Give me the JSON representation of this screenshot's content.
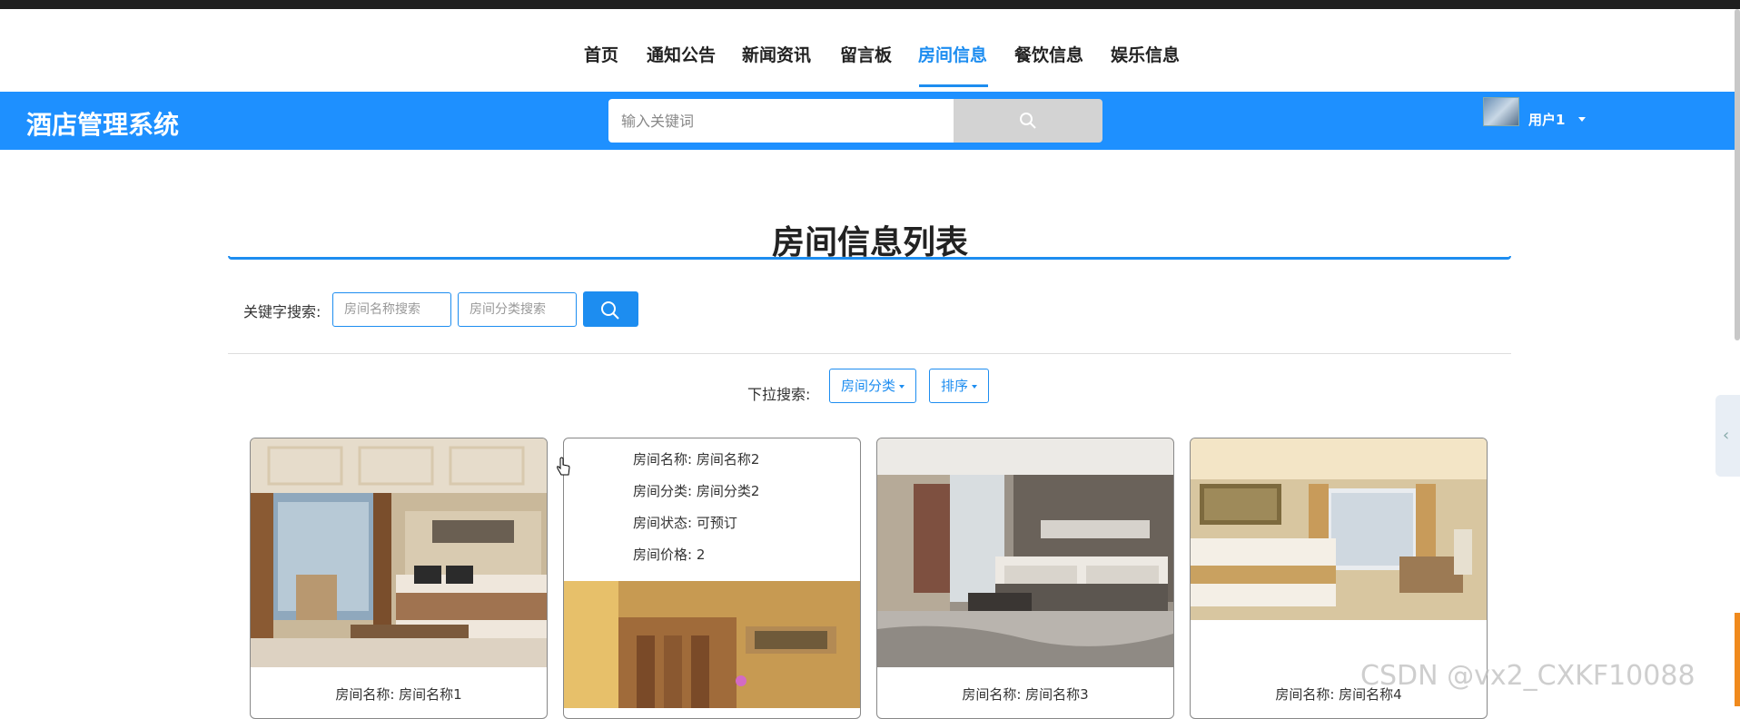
{
  "nav": {
    "items": [
      {
        "label": "首页"
      },
      {
        "label": "通知公告"
      },
      {
        "label": "新闻资讯"
      },
      {
        "label": "留言板"
      },
      {
        "label": "房间信息"
      },
      {
        "label": "餐饮信息"
      },
      {
        "label": "娱乐信息"
      }
    ],
    "active": "房间信息"
  },
  "header": {
    "logo": "酒店管理系统",
    "search_placeholder": "输入关键词",
    "user_name": "用户1"
  },
  "page": {
    "title": "房间信息列表",
    "keyword_label": "关键字搜索:",
    "name_search_placeholder": "房间名称搜索",
    "category_search_placeholder": "房间分类搜索",
    "dropdown_label": "下拉搜索:",
    "dropdown_category": "房间分类",
    "dropdown_sort": "排序"
  },
  "cards": [
    {
      "caption": "房间名称: 房间名称1"
    },
    {
      "hover": [
        "房间名称: 房间名称2",
        "房间分类: 房间分类2",
        "房间状态: 可预订",
        "房间价格: 2"
      ]
    },
    {
      "caption": "房间名称: 房间名称3"
    },
    {
      "caption": "房间名称: 房间名称4"
    }
  ],
  "watermark": "CSDN @vx2_CXKF10088",
  "colors": {
    "primary": "#1e90ff",
    "accent": "#1d8df0"
  }
}
